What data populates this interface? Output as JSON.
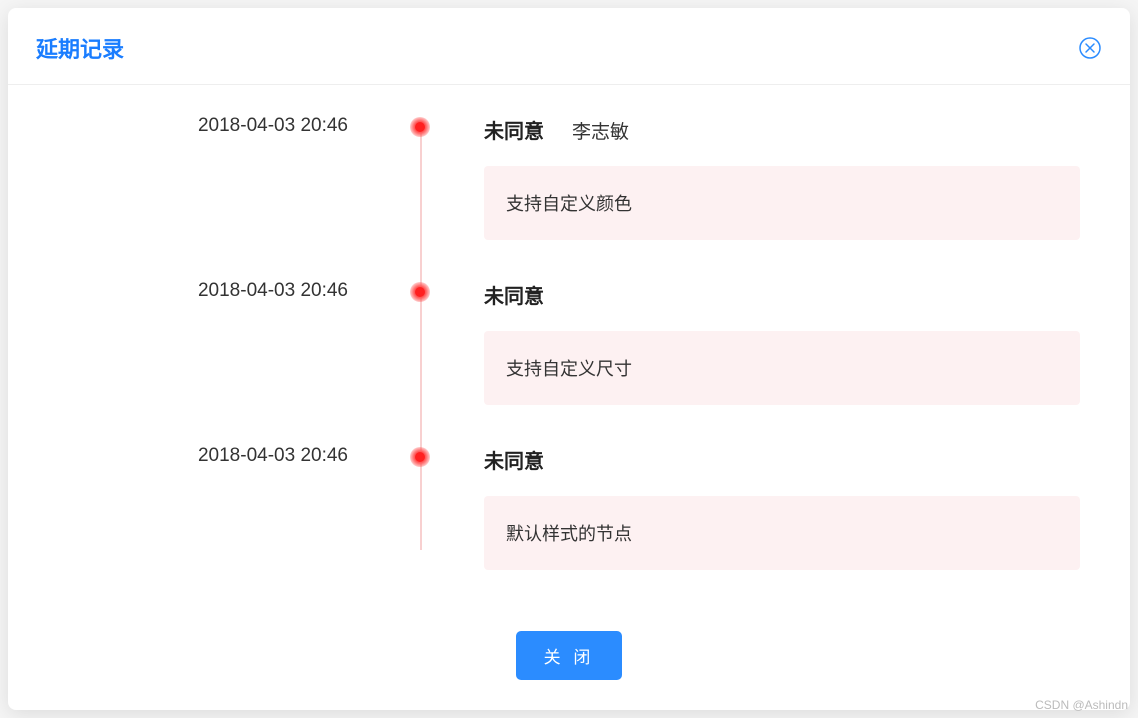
{
  "modal": {
    "title": "延期记录",
    "close_label": "关 闭"
  },
  "timeline": {
    "items": [
      {
        "time": "2018-04-03 20:46",
        "status": "未同意",
        "person": "李志敏",
        "content": "支持自定义颜色"
      },
      {
        "time": "2018-04-03 20:46",
        "status": "未同意",
        "person": "",
        "content": "支持自定义尺寸"
      },
      {
        "time": "2018-04-03 20:46",
        "status": "未同意",
        "person": "",
        "content": "默认样式的节点"
      }
    ]
  },
  "watermark": "CSDN @Ashindn"
}
